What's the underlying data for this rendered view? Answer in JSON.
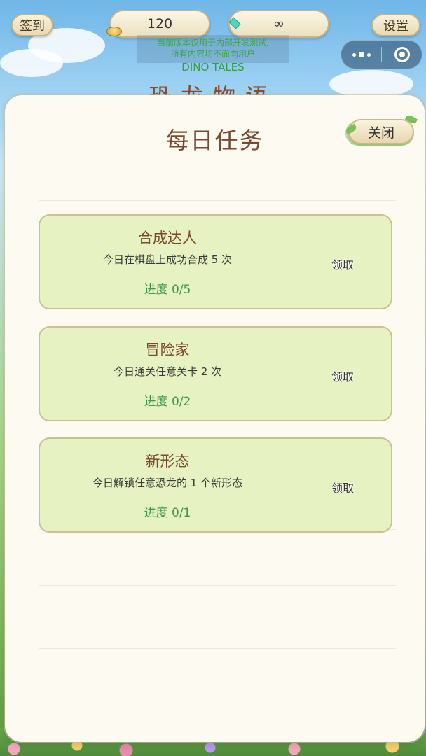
{
  "hud": {
    "signin_label": "签到",
    "coins": "120",
    "gems": "∞",
    "settings_label": "设置"
  },
  "notice": {
    "line1": "当前版本仅用于内部开发测试,",
    "line2": "所有内容均不面向用户"
  },
  "game": {
    "subtitle": "DINO TALES",
    "title": "恐龙物语"
  },
  "modal": {
    "title": "每日任务",
    "close_label": "关闭"
  },
  "tasks": [
    {
      "name": "合成达人",
      "desc": "今日在棋盘上成功合成 5 次",
      "progress": "进度 0/5",
      "claim_label": "领取"
    },
    {
      "name": "冒险家",
      "desc": "今日通关任意关卡 2 次",
      "progress": "进度 0/2",
      "claim_label": "领取"
    },
    {
      "name": "新形态",
      "desc": "今日解锁任意恐龙的 1 个新形态",
      "progress": "进度 0/1",
      "claim_label": "领取"
    }
  ],
  "colors": {
    "card_bg": "#e6f2c2",
    "title_brown": "#7a4a30",
    "progress_green": "#3e9a4a",
    "modal_bg": "#fdfbf1"
  },
  "icons": {
    "coin": "coin-icon",
    "gem": "gem-icon",
    "more": "more-icon",
    "close_capsule": "close-circle-icon"
  }
}
